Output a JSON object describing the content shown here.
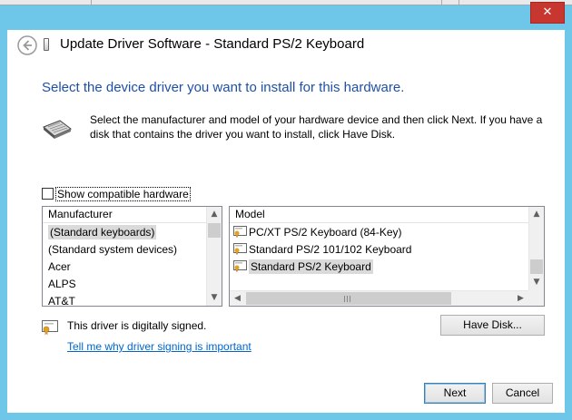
{
  "window": {
    "title": "Update Driver Software - Standard PS/2 Keyboard",
    "close_glyph": "✕"
  },
  "heading": "Select the device driver you want to install for this hardware.",
  "intro": "Select the manufacturer and model of your hardware device and then click Next. If you have a disk that contains the driver you want to install, click Have Disk.",
  "show_compatible": {
    "label": "Show compatible hardware",
    "checked": false
  },
  "manufacturer_list": {
    "header": "Manufacturer",
    "items": [
      "(Standard keyboards)",
      "(Standard system devices)",
      "Acer",
      "ALPS",
      "AT&T"
    ],
    "selected_index": 0
  },
  "model_list": {
    "header": "Model",
    "items": [
      "PC/XT PS/2 Keyboard (84-Key)",
      "Standard PS/2 101/102 Keyboard",
      "Standard PS/2 Keyboard"
    ],
    "selected_index": 2
  },
  "signing": {
    "status": "This driver is digitally signed.",
    "link": "Tell me why driver signing is important"
  },
  "buttons": {
    "have_disk": "Have Disk...",
    "next": "Next",
    "cancel": "Cancel"
  },
  "icons": [
    "back-arrow-icon",
    "device-icon",
    "keyboard-icon",
    "driver-cert-icon",
    "certificate-icon",
    "close-icon"
  ],
  "colors": {
    "accent": "#1e50a8",
    "frame": "#6ec6e8",
    "close": "#c7372f",
    "link": "#0066cc"
  }
}
